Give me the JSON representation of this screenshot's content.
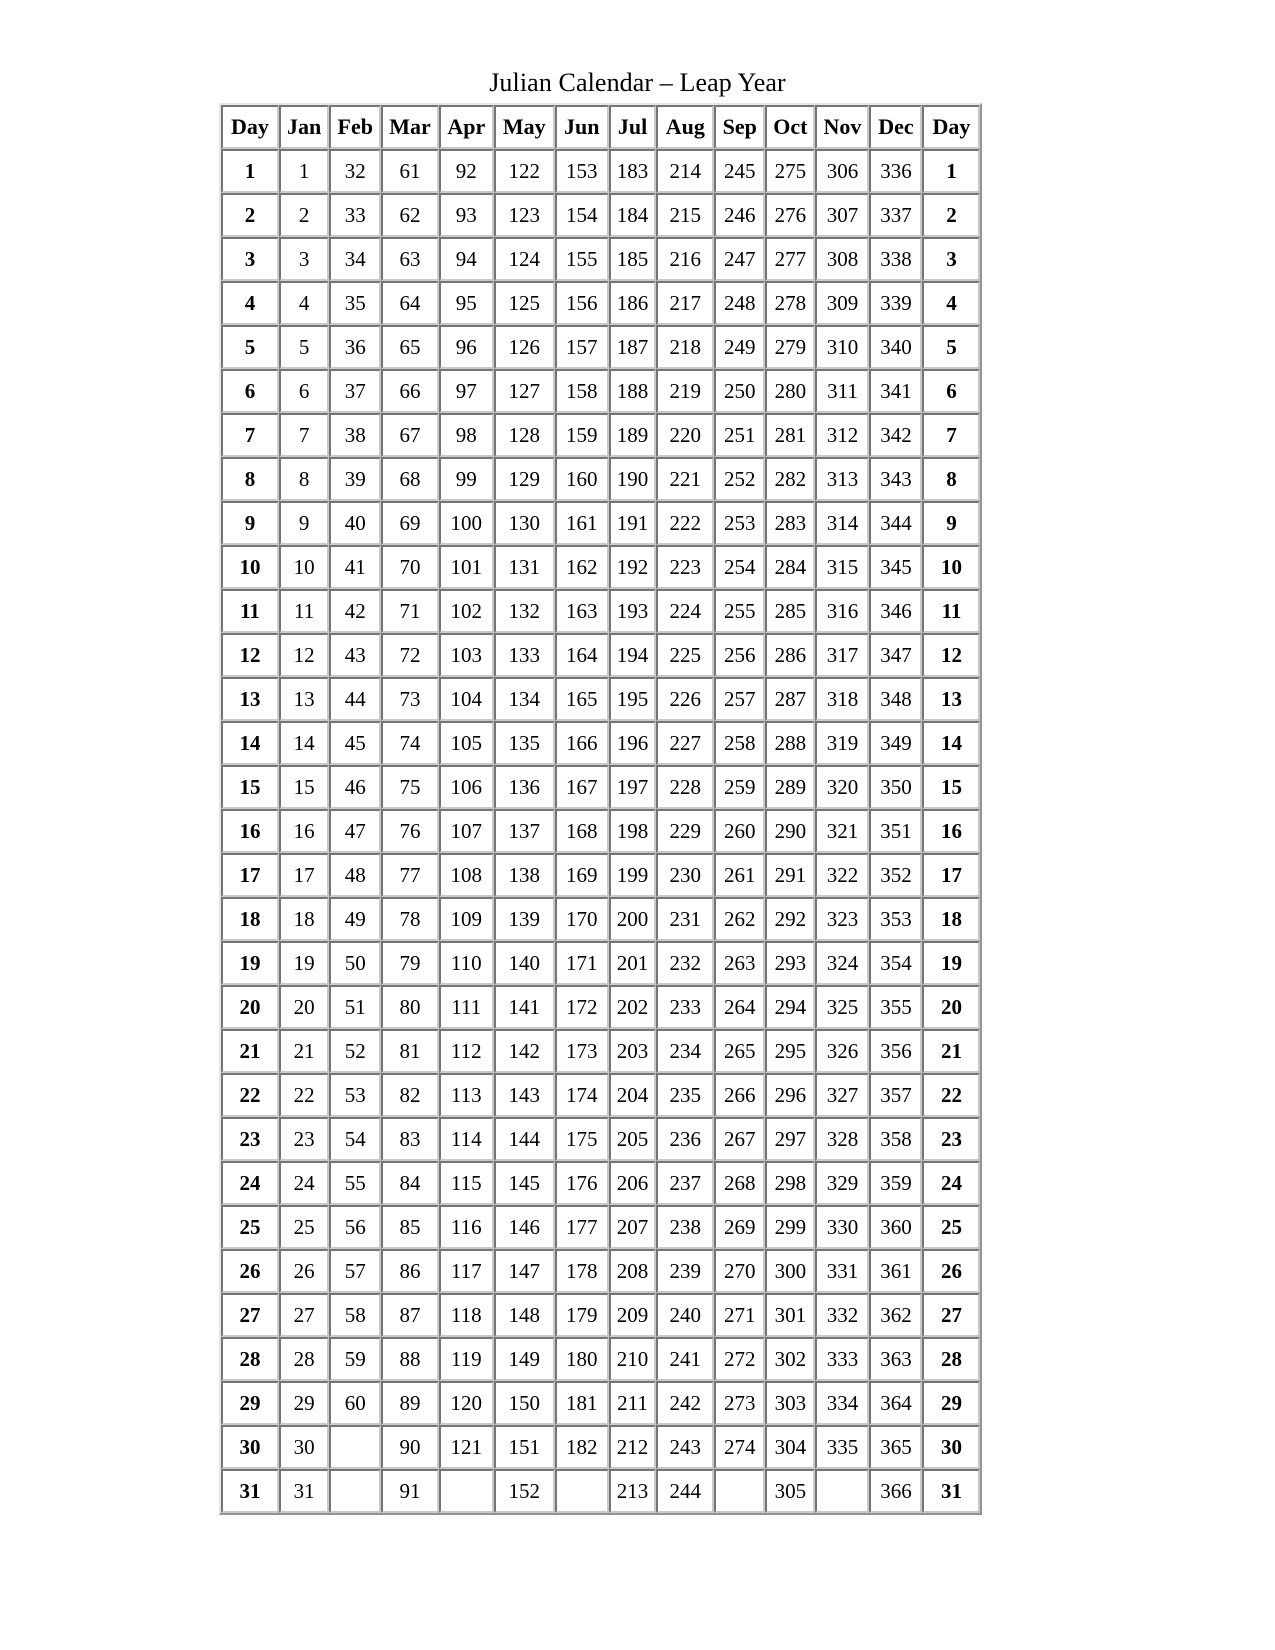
{
  "document": {
    "title": "Julian Calendar – Leap Year"
  },
  "table": {
    "headers": [
      "Day",
      "Jan",
      "Feb",
      "Mar",
      "Apr",
      "May",
      "Jun",
      "Jul",
      "Aug",
      "Sep",
      "Oct",
      "Nov",
      "Dec",
      "Day"
    ],
    "rows": [
      [
        "1",
        "1",
        "32",
        "61",
        "92",
        "122",
        "153",
        "183",
        "214",
        "245",
        "275",
        "306",
        "336",
        "1"
      ],
      [
        "2",
        "2",
        "33",
        "62",
        "93",
        "123",
        "154",
        "184",
        "215",
        "246",
        "276",
        "307",
        "337",
        "2"
      ],
      [
        "3",
        "3",
        "34",
        "63",
        "94",
        "124",
        "155",
        "185",
        "216",
        "247",
        "277",
        "308",
        "338",
        "3"
      ],
      [
        "4",
        "4",
        "35",
        "64",
        "95",
        "125",
        "156",
        "186",
        "217",
        "248",
        "278",
        "309",
        "339",
        "4"
      ],
      [
        "5",
        "5",
        "36",
        "65",
        "96",
        "126",
        "157",
        "187",
        "218",
        "249",
        "279",
        "310",
        "340",
        "5"
      ],
      [
        "6",
        "6",
        "37",
        "66",
        "97",
        "127",
        "158",
        "188",
        "219",
        "250",
        "280",
        "311",
        "341",
        "6"
      ],
      [
        "7",
        "7",
        "38",
        "67",
        "98",
        "128",
        "159",
        "189",
        "220",
        "251",
        "281",
        "312",
        "342",
        "7"
      ],
      [
        "8",
        "8",
        "39",
        "68",
        "99",
        "129",
        "160",
        "190",
        "221",
        "252",
        "282",
        "313",
        "343",
        "8"
      ],
      [
        "9",
        "9",
        "40",
        "69",
        "100",
        "130",
        "161",
        "191",
        "222",
        "253",
        "283",
        "314",
        "344",
        "9"
      ],
      [
        "10",
        "10",
        "41",
        "70",
        "101",
        "131",
        "162",
        "192",
        "223",
        "254",
        "284",
        "315",
        "345",
        "10"
      ],
      [
        "11",
        "11",
        "42",
        "71",
        "102",
        "132",
        "163",
        "193",
        "224",
        "255",
        "285",
        "316",
        "346",
        "11"
      ],
      [
        "12",
        "12",
        "43",
        "72",
        "103",
        "133",
        "164",
        "194",
        "225",
        "256",
        "286",
        "317",
        "347",
        "12"
      ],
      [
        "13",
        "13",
        "44",
        "73",
        "104",
        "134",
        "165",
        "195",
        "226",
        "257",
        "287",
        "318",
        "348",
        "13"
      ],
      [
        "14",
        "14",
        "45",
        "74",
        "105",
        "135",
        "166",
        "196",
        "227",
        "258",
        "288",
        "319",
        "349",
        "14"
      ],
      [
        "15",
        "15",
        "46",
        "75",
        "106",
        "136",
        "167",
        "197",
        "228",
        "259",
        "289",
        "320",
        "350",
        "15"
      ],
      [
        "16",
        "16",
        "47",
        "76",
        "107",
        "137",
        "168",
        "198",
        "229",
        "260",
        "290",
        "321",
        "351",
        "16"
      ],
      [
        "17",
        "17",
        "48",
        "77",
        "108",
        "138",
        "169",
        "199",
        "230",
        "261",
        "291",
        "322",
        "352",
        "17"
      ],
      [
        "18",
        "18",
        "49",
        "78",
        "109",
        "139",
        "170",
        "200",
        "231",
        "262",
        "292",
        "323",
        "353",
        "18"
      ],
      [
        "19",
        "19",
        "50",
        "79",
        "110",
        "140",
        "171",
        "201",
        "232",
        "263",
        "293",
        "324",
        "354",
        "19"
      ],
      [
        "20",
        "20",
        "51",
        "80",
        "111",
        "141",
        "172",
        "202",
        "233",
        "264",
        "294",
        "325",
        "355",
        "20"
      ],
      [
        "21",
        "21",
        "52",
        "81",
        "112",
        "142",
        "173",
        "203",
        "234",
        "265",
        "295",
        "326",
        "356",
        "21"
      ],
      [
        "22",
        "22",
        "53",
        "82",
        "113",
        "143",
        "174",
        "204",
        "235",
        "266",
        "296",
        "327",
        "357",
        "22"
      ],
      [
        "23",
        "23",
        "54",
        "83",
        "114",
        "144",
        "175",
        "205",
        "236",
        "267",
        "297",
        "328",
        "358",
        "23"
      ],
      [
        "24",
        "24",
        "55",
        "84",
        "115",
        "145",
        "176",
        "206",
        "237",
        "268",
        "298",
        "329",
        "359",
        "24"
      ],
      [
        "25",
        "25",
        "56",
        "85",
        "116",
        "146",
        "177",
        "207",
        "238",
        "269",
        "299",
        "330",
        "360",
        "25"
      ],
      [
        "26",
        "26",
        "57",
        "86",
        "117",
        "147",
        "178",
        "208",
        "239",
        "270",
        "300",
        "331",
        "361",
        "26"
      ],
      [
        "27",
        "27",
        "58",
        "87",
        "118",
        "148",
        "179",
        "209",
        "240",
        "271",
        "301",
        "332",
        "362",
        "27"
      ],
      [
        "28",
        "28",
        "59",
        "88",
        "119",
        "149",
        "180",
        "210",
        "241",
        "272",
        "302",
        "333",
        "363",
        "28"
      ],
      [
        "29",
        "29",
        "60",
        "89",
        "120",
        "150",
        "181",
        "211",
        "242",
        "273",
        "303",
        "334",
        "364",
        "29"
      ],
      [
        "30",
        "30",
        "",
        "90",
        "121",
        "151",
        "182",
        "212",
        "243",
        "274",
        "304",
        "335",
        "365",
        "30"
      ],
      [
        "31",
        "31",
        "",
        "91",
        "",
        "152",
        "",
        "213",
        "244",
        "",
        "305",
        "",
        "366",
        "31"
      ]
    ]
  }
}
